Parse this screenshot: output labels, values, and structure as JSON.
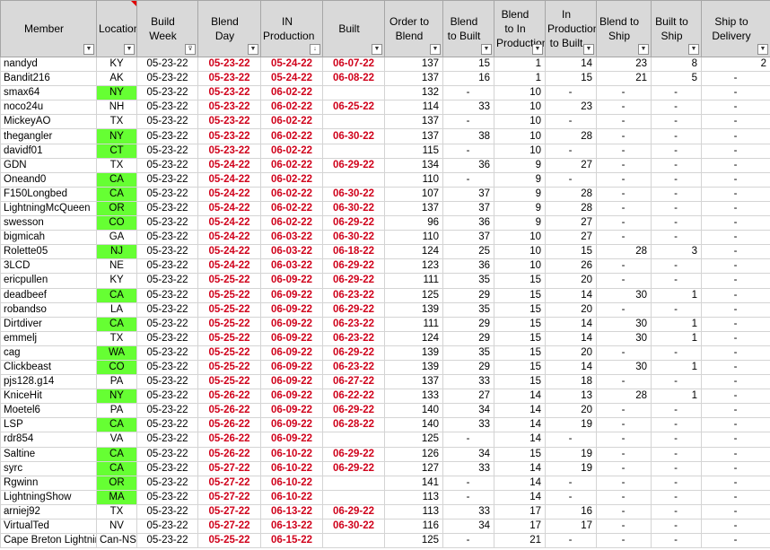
{
  "headers": {
    "member": "Member",
    "location": "Location",
    "build_week": "Build Week",
    "blend_day": "Blend Day",
    "in_production": "IN Production",
    "built": "Built",
    "order_to_blend": "Order to Blend",
    "blend_to_built": "Blend to Built",
    "blend_to_in_production": "Blend to In Production",
    "in_production_to_built": "In Production to Built",
    "blend_to_ship": "Blend to Ship",
    "built_to_ship": "Built to Ship",
    "ship_to_delivery": "Ship to Delivery"
  },
  "colors": {
    "red_text": "#d0021b",
    "green_fill": "#66ff33",
    "header_bg": "#d9d9d9"
  },
  "rows": [
    {
      "member": "nandyd",
      "loc": "KY",
      "green": false,
      "week": "05-23-22",
      "blend": "05-23-22",
      "inprod": "05-24-22",
      "built": "06-07-22",
      "o2b": "137",
      "b2built": "15",
      "b2inp": "1",
      "inp2b": "14",
      "b2ship": "23",
      "built2ship": "8",
      "ship2del": "2"
    },
    {
      "member": "Bandit216",
      "loc": "AK",
      "green": false,
      "week": "05-23-22",
      "blend": "05-23-22",
      "inprod": "05-24-22",
      "built": "06-08-22",
      "o2b": "137",
      "b2built": "16",
      "b2inp": "1",
      "inp2b": "15",
      "b2ship": "21",
      "built2ship": "5",
      "ship2del": "-"
    },
    {
      "member": "smax64",
      "loc": "NY",
      "green": true,
      "week": "05-23-22",
      "blend": "05-23-22",
      "inprod": "06-02-22",
      "built": "",
      "o2b": "132",
      "b2built": "-",
      "b2inp": "10",
      "inp2b": "-",
      "b2ship": "-",
      "built2ship": "-",
      "ship2del": "-"
    },
    {
      "member": "noco24u",
      "loc": "NH",
      "green": false,
      "week": "05-23-22",
      "blend": "05-23-22",
      "inprod": "06-02-22",
      "built": "06-25-22",
      "o2b": "114",
      "b2built": "33",
      "b2inp": "10",
      "inp2b": "23",
      "b2ship": "-",
      "built2ship": "-",
      "ship2del": "-"
    },
    {
      "member": "MickeyAO",
      "loc": "TX",
      "green": false,
      "week": "05-23-22",
      "blend": "05-23-22",
      "inprod": "06-02-22",
      "built": "",
      "o2b": "137",
      "b2built": "-",
      "b2inp": "10",
      "inp2b": "-",
      "b2ship": "-",
      "built2ship": "-",
      "ship2del": "-"
    },
    {
      "member": "thegangler",
      "loc": "NY",
      "green": true,
      "week": "05-23-22",
      "blend": "05-23-22",
      "inprod": "06-02-22",
      "built": "06-30-22",
      "o2b": "137",
      "b2built": "38",
      "b2inp": "10",
      "inp2b": "28",
      "b2ship": "-",
      "built2ship": "-",
      "ship2del": "-"
    },
    {
      "member": "davidf01",
      "loc": "CT",
      "green": true,
      "week": "05-23-22",
      "blend": "05-23-22",
      "inprod": "06-02-22",
      "built": "",
      "o2b": "115",
      "b2built": "-",
      "b2inp": "10",
      "inp2b": "-",
      "b2ship": "-",
      "built2ship": "-",
      "ship2del": "-"
    },
    {
      "member": "GDN",
      "loc": "TX",
      "green": false,
      "week": "05-23-22",
      "blend": "05-24-22",
      "inprod": "06-02-22",
      "built": "06-29-22",
      "o2b": "134",
      "b2built": "36",
      "b2inp": "9",
      "inp2b": "27",
      "b2ship": "-",
      "built2ship": "-",
      "ship2del": "-"
    },
    {
      "member": "Oneand0",
      "loc": "CA",
      "green": true,
      "week": "05-23-22",
      "blend": "05-24-22",
      "inprod": "06-02-22",
      "built": "",
      "o2b": "110",
      "b2built": "-",
      "b2inp": "9",
      "inp2b": "-",
      "b2ship": "-",
      "built2ship": "-",
      "ship2del": "-"
    },
    {
      "member": "F150Longbed",
      "loc": "CA",
      "green": true,
      "week": "05-23-22",
      "blend": "05-24-22",
      "inprod": "06-02-22",
      "built": "06-30-22",
      "o2b": "107",
      "b2built": "37",
      "b2inp": "9",
      "inp2b": "28",
      "b2ship": "-",
      "built2ship": "-",
      "ship2del": "-"
    },
    {
      "member": "LightningMcQueen",
      "loc": "OR",
      "green": true,
      "week": "05-23-22",
      "blend": "05-24-22",
      "inprod": "06-02-22",
      "built": "06-30-22",
      "o2b": "137",
      "b2built": "37",
      "b2inp": "9",
      "inp2b": "28",
      "b2ship": "-",
      "built2ship": "-",
      "ship2del": "-"
    },
    {
      "member": "swesson",
      "loc": "CO",
      "green": true,
      "week": "05-23-22",
      "blend": "05-24-22",
      "inprod": "06-02-22",
      "built": "06-29-22",
      "o2b": "96",
      "b2built": "36",
      "b2inp": "9",
      "inp2b": "27",
      "b2ship": "-",
      "built2ship": "-",
      "ship2del": "-"
    },
    {
      "member": "bigmicah",
      "loc": "GA",
      "green": false,
      "week": "05-23-22",
      "blend": "05-24-22",
      "inprod": "06-03-22",
      "built": "06-30-22",
      "o2b": "110",
      "b2built": "37",
      "b2inp": "10",
      "inp2b": "27",
      "b2ship": "-",
      "built2ship": "-",
      "ship2del": "-"
    },
    {
      "member": "Rolette05",
      "loc": "NJ",
      "green": true,
      "week": "05-23-22",
      "blend": "05-24-22",
      "inprod": "06-03-22",
      "built": "06-18-22",
      "o2b": "124",
      "b2built": "25",
      "b2inp": "10",
      "inp2b": "15",
      "b2ship": "28",
      "built2ship": "3",
      "ship2del": "-"
    },
    {
      "member": "3LCD",
      "loc": "NE",
      "green": false,
      "week": "05-23-22",
      "blend": "05-24-22",
      "inprod": "06-03-22",
      "built": "06-29-22",
      "o2b": "123",
      "b2built": "36",
      "b2inp": "10",
      "inp2b": "26",
      "b2ship": "-",
      "built2ship": "-",
      "ship2del": "-"
    },
    {
      "member": "ericpullen",
      "loc": "KY",
      "green": false,
      "week": "05-23-22",
      "blend": "05-25-22",
      "inprod": "06-09-22",
      "built": "06-29-22",
      "o2b": "111",
      "b2built": "35",
      "b2inp": "15",
      "inp2b": "20",
      "b2ship": "-",
      "built2ship": "-",
      "ship2del": "-"
    },
    {
      "member": "deadbeef",
      "loc": "CA",
      "green": true,
      "week": "05-23-22",
      "blend": "05-25-22",
      "inprod": "06-09-22",
      "built": "06-23-22",
      "o2b": "125",
      "b2built": "29",
      "b2inp": "15",
      "inp2b": "14",
      "b2ship": "30",
      "built2ship": "1",
      "ship2del": "-"
    },
    {
      "member": "robandso",
      "loc": "LA",
      "green": false,
      "week": "05-23-22",
      "blend": "05-25-22",
      "inprod": "06-09-22",
      "built": "06-29-22",
      "o2b": "139",
      "b2built": "35",
      "b2inp": "15",
      "inp2b": "20",
      "b2ship": "-",
      "built2ship": "-",
      "ship2del": "-"
    },
    {
      "member": "Dirtdiver",
      "loc": "CA",
      "green": true,
      "week": "05-23-22",
      "blend": "05-25-22",
      "inprod": "06-09-22",
      "built": "06-23-22",
      "o2b": "111",
      "b2built": "29",
      "b2inp": "15",
      "inp2b": "14",
      "b2ship": "30",
      "built2ship": "1",
      "ship2del": "-"
    },
    {
      "member": "emmelj",
      "loc": "TX",
      "green": false,
      "week": "05-23-22",
      "blend": "05-25-22",
      "inprod": "06-09-22",
      "built": "06-23-22",
      "o2b": "124",
      "b2built": "29",
      "b2inp": "15",
      "inp2b": "14",
      "b2ship": "30",
      "built2ship": "1",
      "ship2del": "-"
    },
    {
      "member": "cag",
      "loc": "WA",
      "green": true,
      "week": "05-23-22",
      "blend": "05-25-22",
      "inprod": "06-09-22",
      "built": "06-29-22",
      "o2b": "139",
      "b2built": "35",
      "b2inp": "15",
      "inp2b": "20",
      "b2ship": "-",
      "built2ship": "-",
      "ship2del": "-"
    },
    {
      "member": "Clickbeast",
      "loc": "CO",
      "green": true,
      "week": "05-23-22",
      "blend": "05-25-22",
      "inprod": "06-09-22",
      "built": "06-23-22",
      "o2b": "139",
      "b2built": "29",
      "b2inp": "15",
      "inp2b": "14",
      "b2ship": "30",
      "built2ship": "1",
      "ship2del": "-"
    },
    {
      "member": "pjs128.g14",
      "loc": "PA",
      "green": false,
      "week": "05-23-22",
      "blend": "05-25-22",
      "inprod": "06-09-22",
      "built": "06-27-22",
      "o2b": "137",
      "b2built": "33",
      "b2inp": "15",
      "inp2b": "18",
      "b2ship": "-",
      "built2ship": "-",
      "ship2del": "-"
    },
    {
      "member": "KniceHit",
      "loc": "NY",
      "green": true,
      "week": "05-23-22",
      "blend": "05-26-22",
      "inprod": "06-09-22",
      "built": "06-22-22",
      "o2b": "133",
      "b2built": "27",
      "b2inp": "14",
      "inp2b": "13",
      "b2ship": "28",
      "built2ship": "1",
      "ship2del": "-"
    },
    {
      "member": "Moetel6",
      "loc": "PA",
      "green": false,
      "week": "05-23-22",
      "blend": "05-26-22",
      "inprod": "06-09-22",
      "built": "06-29-22",
      "o2b": "140",
      "b2built": "34",
      "b2inp": "14",
      "inp2b": "20",
      "b2ship": "-",
      "built2ship": "-",
      "ship2del": "-"
    },
    {
      "member": "LSP",
      "loc": "CA",
      "green": true,
      "week": "05-23-22",
      "blend": "05-26-22",
      "inprod": "06-09-22",
      "built": "06-28-22",
      "o2b": "140",
      "b2built": "33",
      "b2inp": "14",
      "inp2b": "19",
      "b2ship": "-",
      "built2ship": "-",
      "ship2del": "-"
    },
    {
      "member": "rdr854",
      "loc": "VA",
      "green": false,
      "week": "05-23-22",
      "blend": "05-26-22",
      "inprod": "06-09-22",
      "built": "",
      "o2b": "125",
      "b2built": "-",
      "b2inp": "14",
      "inp2b": "-",
      "b2ship": "-",
      "built2ship": "-",
      "ship2del": "-"
    },
    {
      "member": "Saltine",
      "loc": "CA",
      "green": true,
      "week": "05-23-22",
      "blend": "05-26-22",
      "inprod": "06-10-22",
      "built": "06-29-22",
      "o2b": "126",
      "b2built": "34",
      "b2inp": "15",
      "inp2b": "19",
      "b2ship": "-",
      "built2ship": "-",
      "ship2del": "-"
    },
    {
      "member": "syrc",
      "loc": "CA",
      "green": true,
      "week": "05-23-22",
      "blend": "05-27-22",
      "inprod": "06-10-22",
      "built": "06-29-22",
      "o2b": "127",
      "b2built": "33",
      "b2inp": "14",
      "inp2b": "19",
      "b2ship": "-",
      "built2ship": "-",
      "ship2del": "-"
    },
    {
      "member": "Rgwinn",
      "loc": "OR",
      "green": true,
      "week": "05-23-22",
      "blend": "05-27-22",
      "inprod": "06-10-22",
      "built": "",
      "o2b": "141",
      "b2built": "-",
      "b2inp": "14",
      "inp2b": "-",
      "b2ship": "-",
      "built2ship": "-",
      "ship2del": "-"
    },
    {
      "member": "LightningShow",
      "loc": "MA",
      "green": true,
      "week": "05-23-22",
      "blend": "05-27-22",
      "inprod": "06-10-22",
      "built": "",
      "o2b": "113",
      "b2built": "-",
      "b2inp": "14",
      "inp2b": "-",
      "b2ship": "-",
      "built2ship": "-",
      "ship2del": "-"
    },
    {
      "member": "arniej92",
      "loc": "TX",
      "green": false,
      "week": "05-23-22",
      "blend": "05-27-22",
      "inprod": "06-13-22",
      "built": "06-29-22",
      "o2b": "113",
      "b2built": "33",
      "b2inp": "17",
      "inp2b": "16",
      "b2ship": "-",
      "built2ship": "-",
      "ship2del": "-"
    },
    {
      "member": "VirtualTed",
      "loc": "NV",
      "green": false,
      "week": "05-23-22",
      "blend": "05-27-22",
      "inprod": "06-13-22",
      "built": "06-30-22",
      "o2b": "116",
      "b2built": "34",
      "b2inp": "17",
      "inp2b": "17",
      "b2ship": "-",
      "built2ship": "-",
      "ship2del": "-"
    },
    {
      "member": "Cape Breton Lightning",
      "loc": "Can-NS",
      "green": false,
      "week": "05-23-22",
      "blend": "05-25-22",
      "inprod": "06-15-22",
      "built": "",
      "o2b": "125",
      "b2built": "-",
      "b2inp": "21",
      "inp2b": "-",
      "b2ship": "-",
      "built2ship": "-",
      "ship2del": "-"
    }
  ]
}
